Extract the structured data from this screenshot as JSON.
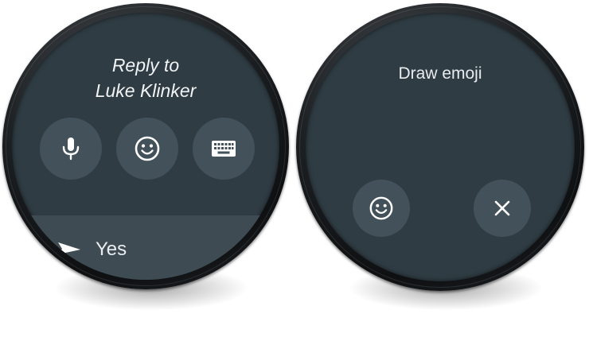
{
  "left_watch": {
    "title_line1": "Reply to",
    "title_line2": "Luke Klinker",
    "actions": [
      {
        "icon": "microphone-icon"
      },
      {
        "icon": "emoji-icon"
      },
      {
        "icon": "keyboard-icon"
      }
    ],
    "suggestion": {
      "icon": "send-icon",
      "label": "Yes"
    }
  },
  "right_watch": {
    "title": "Draw emoji",
    "actions": [
      {
        "icon": "emoji-icon"
      },
      {
        "icon": "close-icon"
      }
    ]
  },
  "colors": {
    "screen": "#2f3c43",
    "button": "#43525a",
    "suggestion_row": "#3e4b52",
    "text": "#f1f3f4"
  }
}
